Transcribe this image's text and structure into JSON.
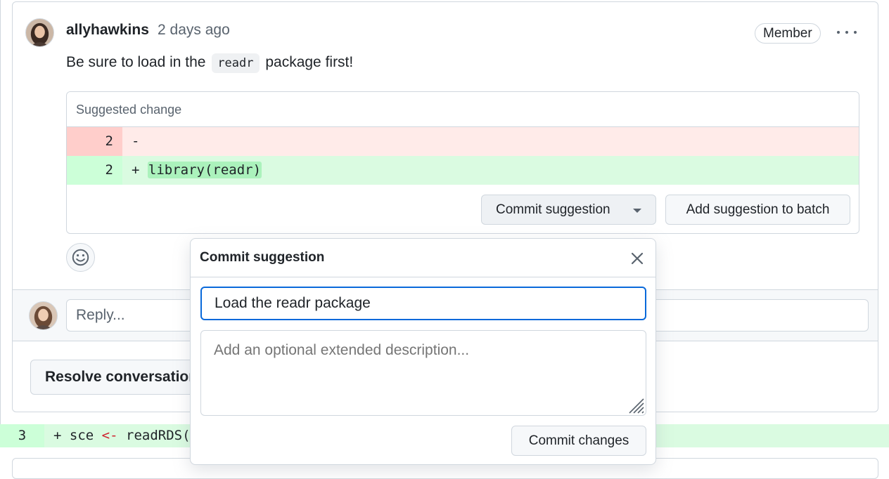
{
  "comment": {
    "author": "allyhawkins",
    "time": "2 days ago",
    "badge": "Member",
    "body_before": "Be sure to load in the ",
    "body_code": "readr",
    "body_after": " package first!"
  },
  "suggestion": {
    "header": "Suggested change",
    "rows": [
      {
        "line": "2",
        "sign": "-",
        "code": ""
      },
      {
        "line": "2",
        "sign": "+",
        "code": "library(readr)"
      }
    ],
    "commit_button": "Commit suggestion",
    "batch_button": "Add suggestion to batch"
  },
  "reply": {
    "placeholder": "Reply..."
  },
  "resolve_button": "Resolve conversation",
  "bottom_diff": {
    "line": "3",
    "sign": "+",
    "code_before": "sce ",
    "operator": "<-",
    "code_after": " readRDS("
  },
  "popover": {
    "title": "Commit suggestion",
    "summary_value": "Load the readr package",
    "description_placeholder": "Add an optional extended description...",
    "commit_button": "Commit changes"
  },
  "icons": {
    "more": "kebab-horizontal-icon",
    "reaction": "smiley-icon",
    "close": "x-icon",
    "dropdown": "triangle-down-icon"
  },
  "colors": {
    "accent": "#0969da",
    "deletion_bg": "#ffebe9",
    "addition_bg": "#dafbe1",
    "border": "#d0d7de"
  }
}
